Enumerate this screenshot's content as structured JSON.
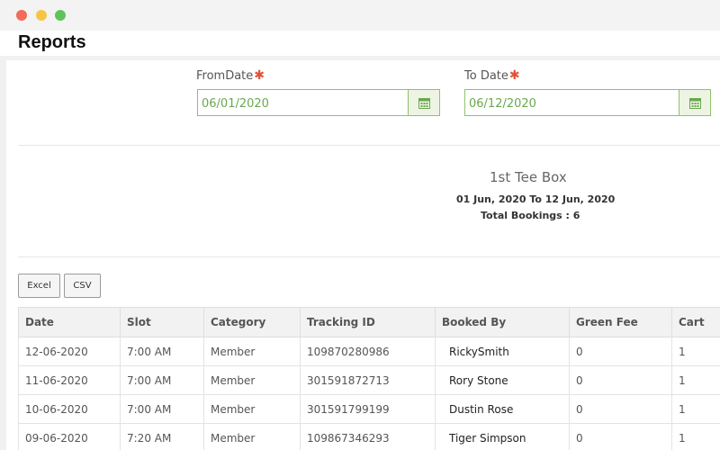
{
  "header": {
    "title": "Reports"
  },
  "filters": {
    "from_label": "FromDate",
    "from_value": "06/01/2020",
    "to_label": "To Date",
    "to_value": "06/12/2020",
    "required_mark": "✱"
  },
  "report": {
    "name": "1st Tee Box",
    "range": "01 Jun, 2020 To 12 Jun, 2020",
    "total": "Total Bookings : 6"
  },
  "export": {
    "excel_label": "Excel",
    "csv_label": "CSV"
  },
  "table": {
    "columns": [
      "Date",
      "Slot",
      "Category",
      "Tracking ID",
      "Booked By",
      "Green Fee",
      "Cart"
    ],
    "rows": [
      [
        "12-06-2020",
        "7:00 AM",
        "Member",
        "109870280986",
        "RickySmith",
        "0",
        "1"
      ],
      [
        "11-06-2020",
        "7:00 AM",
        "Member",
        "301591872713",
        "Rory Stone",
        "0",
        "1"
      ],
      [
        "10-06-2020",
        "7:00 AM",
        "Member",
        "301591799199",
        "Dustin Rose",
        "0",
        "1"
      ],
      [
        "09-06-2020",
        "7:20 AM",
        "Member",
        "109867346293",
        "Tiger Simpson",
        "0",
        "1"
      ]
    ]
  },
  "colors": {
    "accent": "#8fc26a",
    "required": "#e05236"
  },
  "icons": {
    "calendar": "calendar-icon"
  }
}
